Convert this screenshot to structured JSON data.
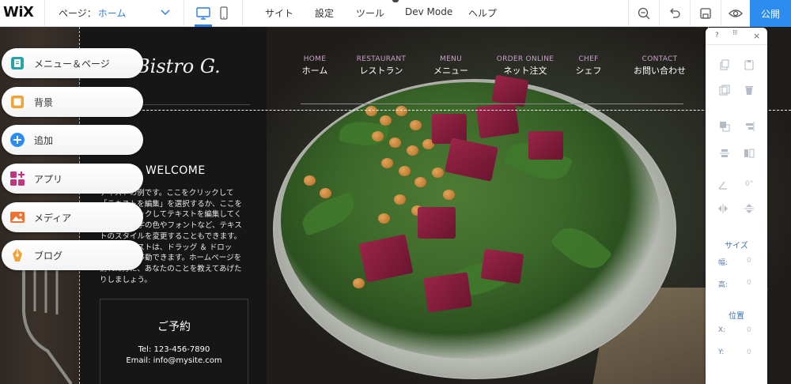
{
  "topbar": {
    "logo": "WiX",
    "page_label": "ページ：",
    "page_value": "ホーム",
    "menu": [
      "サイト",
      "設定",
      "ツール",
      "Dev Mode",
      "ヘルプ"
    ],
    "publish": "公開"
  },
  "left_panel": {
    "items": [
      {
        "label": "メニュー＆ページ",
        "color": "#29a3a3"
      },
      {
        "label": "背景",
        "color": "#f0a33a"
      },
      {
        "label": "追加",
        "color": "#2d8cf0"
      },
      {
        "label": "アプリ",
        "color": "#c2367f"
      },
      {
        "label": "メディア",
        "color": "#ef7430"
      },
      {
        "label": "ブログ",
        "color": "#f0a33a"
      }
    ]
  },
  "site": {
    "brand": "Bistro G.",
    "nav": [
      {
        "en": "HOME",
        "ja": "ホーム"
      },
      {
        "en": "RESTAURANT",
        "ja": "レストラン"
      },
      {
        "en": "MENU",
        "ja": "メニュー"
      },
      {
        "en": "ORDER ONLINE",
        "ja": "ネット注文"
      },
      {
        "en": "CHEF",
        "ja": "シェフ"
      },
      {
        "en": "CONTACT",
        "ja": "お問い合わせ"
      }
    ],
    "welcome": "WELCOME",
    "body_lines": [
      "テキストの例です。ここをクリックして",
      "「テキストを編集」を選択するか、ここを",
      "ダブルクリックしてテキストを編集してく",
      "ださい。文字の色やフォントなど、テキス",
      "トのスタイルを変更することもできます。",
      "また、テキストは、ドラッグ ＆ ドロッ",
      "プで自由に移動できます。ホームページを",
      "訪れた方に、あなたのことを教えてあげた",
      "りしましょう。"
    ],
    "reserve_title": "ご予約",
    "tel": "Tel:  123-456-7890",
    "email": "Email:  info@mysite.com"
  },
  "right_panel": {
    "help": "?",
    "close": "×",
    "angle": "0°",
    "size_title": "サイズ",
    "width_label": "幅:",
    "width_value": "0",
    "height_label": "高:",
    "height_value": "0",
    "position_title": "位置",
    "x_label": "X:",
    "x_value": "0",
    "y_label": "Y:",
    "y_value": "0"
  }
}
